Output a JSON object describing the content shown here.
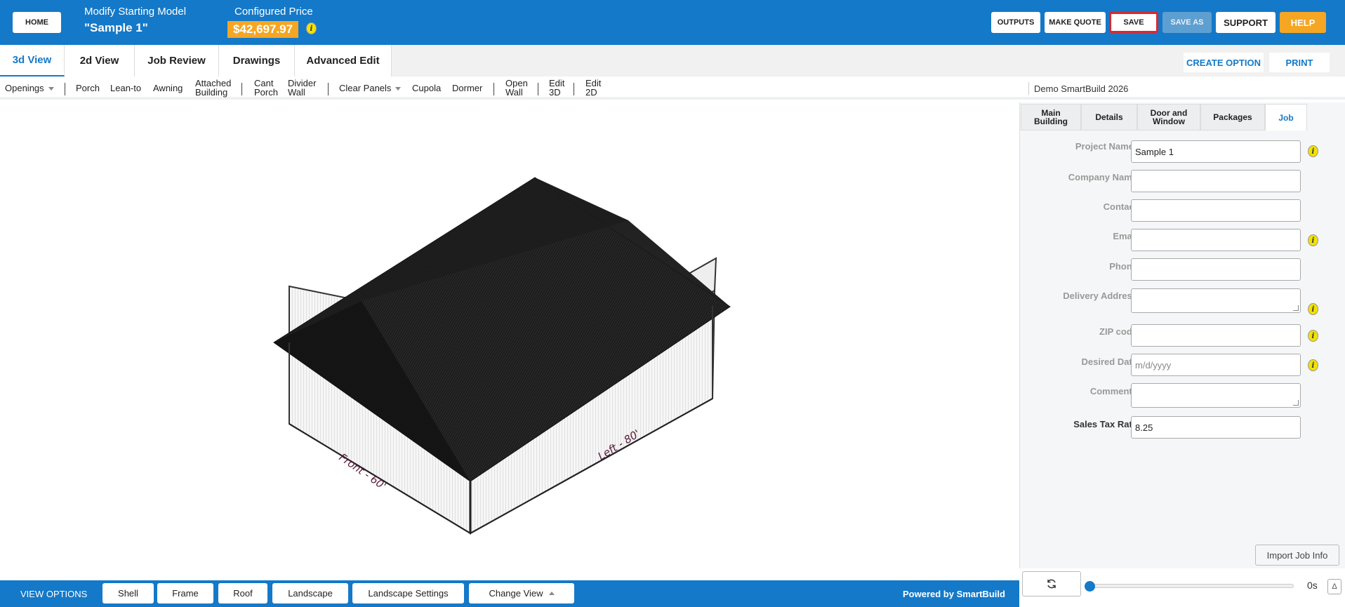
{
  "header": {
    "home_label": "HOME",
    "model_label": "Modify Starting Model",
    "model_name": "\"Sample 1\"",
    "price_label": "Configured Price",
    "price_value": "$42,697.97",
    "info_glyph": "i",
    "buttons": {
      "outputs": "OUTPUTS",
      "make_quote": "MAKE QUOTE",
      "save": "SAVE",
      "save_as": "SAVE AS",
      "support": "SUPPORT",
      "help": "HELP"
    },
    "accent_color": "#1479c8",
    "price_color": "#f5a623"
  },
  "tabs": {
    "items": [
      "3d View",
      "2d View",
      "Job Review",
      "Drawings",
      "Advanced Edit"
    ],
    "active": "3d View",
    "create_option": "CREATE OPTION",
    "print": "PRINT"
  },
  "toolbar": {
    "openings": "Openings",
    "porch": "Porch",
    "lean_to": "Lean-to",
    "awning": "Awning",
    "attached_1": "Attached",
    "attached_2": "Building",
    "cant_1": "Cant",
    "cant_2": "Porch",
    "divider_1": "Divider",
    "divider_2": "Wall",
    "clear_panels": "Clear Panels",
    "cupola": "Cupola",
    "dormer": "Dormer",
    "open_1": "Open",
    "open_2": "Wall",
    "edit3d_1": "Edit",
    "edit3d_2": "3D",
    "edit2d_1": "Edit",
    "edit2d_2": "2D",
    "demo_label": "Demo SmartBuild 2026"
  },
  "building": {
    "front_label": "Front - 60'",
    "left_label": "Left - 80'"
  },
  "panel": {
    "tabs": {
      "main_1": "Main",
      "main_2": "Building",
      "details": "Details",
      "door_1": "Door and",
      "door_2": "Window",
      "packages": "Packages",
      "job": "Job"
    },
    "active_tab": "Job",
    "fields": {
      "project_name": {
        "label": "Project Name",
        "required": "*",
        "value": "Sample 1"
      },
      "company_name": {
        "label": "Company Name",
        "value": ""
      },
      "contact": {
        "label": "Contact",
        "value": ""
      },
      "email": {
        "label": "Email",
        "value": ""
      },
      "phone": {
        "label": "Phone",
        "value": ""
      },
      "delivery_address": {
        "label": "Delivery Address",
        "value": ""
      },
      "zip_code": {
        "label": "ZIP code",
        "value": ""
      },
      "desired_date": {
        "label": "Desired Date",
        "placeholder": "m/d/yyyy"
      },
      "comments": {
        "label": "Comments",
        "value": ""
      },
      "sales_tax_rate": {
        "label": "Sales Tax Rate",
        "value": "8.25"
      }
    },
    "import_button": "Import Job Info"
  },
  "view_options": {
    "label": "VIEW OPTIONS",
    "buttons": [
      "Shell",
      "Frame",
      "Roof",
      "Landscape",
      "Landscape Settings",
      "Change View"
    ],
    "powered_by": "Powered by SmartBuild"
  },
  "playback": {
    "refresh_icon": "refresh-icon",
    "time": "0s",
    "toggle_glyph": "Δ",
    "progress": 0
  }
}
